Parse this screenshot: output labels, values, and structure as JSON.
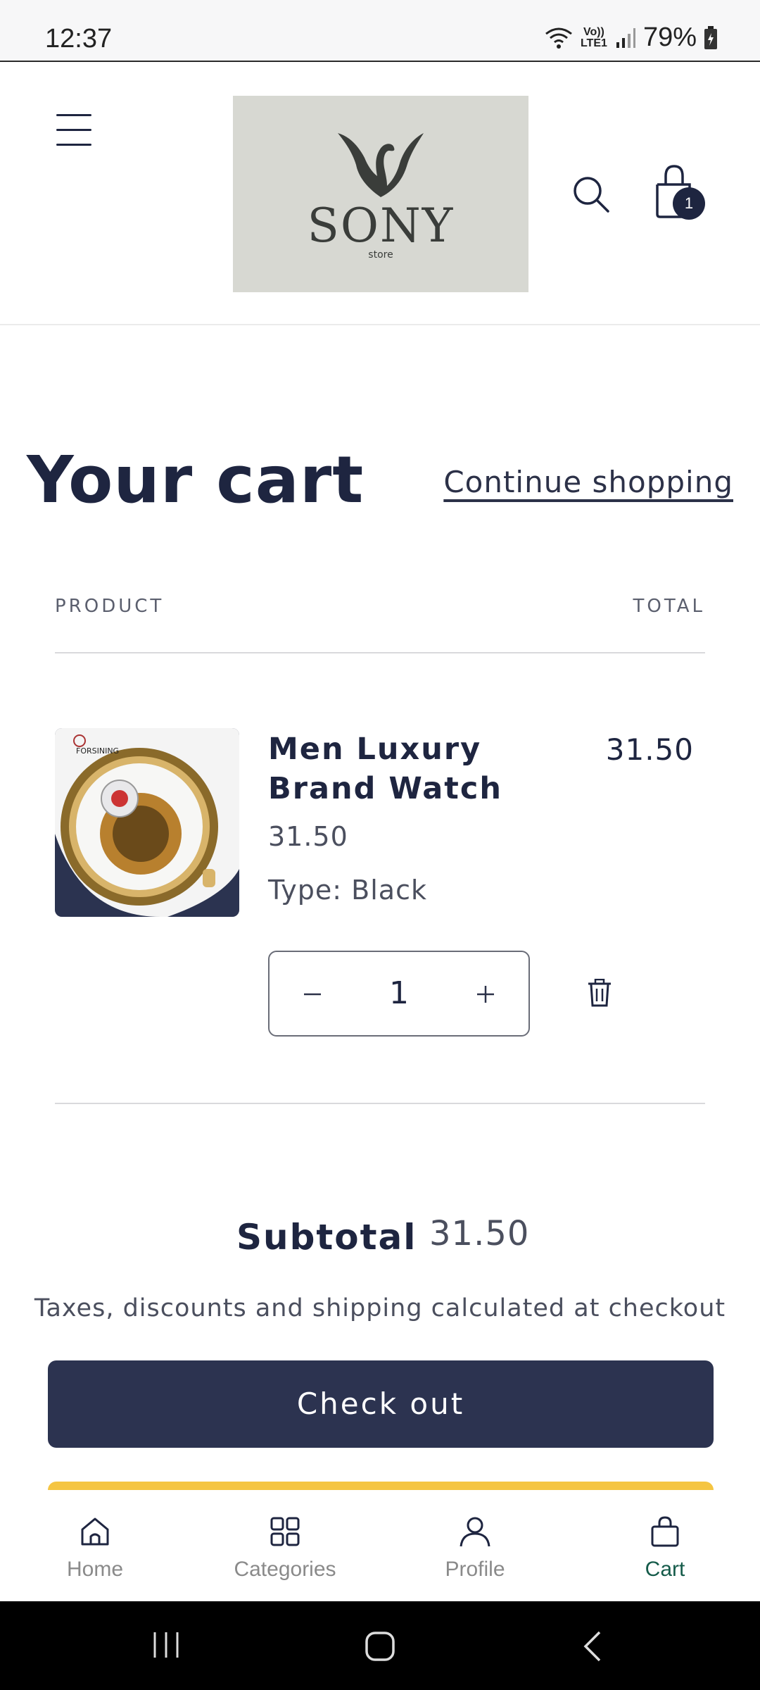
{
  "status_bar": {
    "time": "12:37",
    "network": "Vo)) LTE1",
    "battery": "79%"
  },
  "header": {
    "logo_text": "SONY",
    "logo_subtext": "store",
    "cart_count": "1"
  },
  "cart": {
    "title": "Your cart",
    "continue_label": "Continue shopping",
    "column_product": "PRODUCT",
    "column_total": "TOTAL",
    "items": [
      {
        "brand_mark": "FORSINING",
        "name": "Men Luxury Brand Watch",
        "price": "31.50",
        "variant": "Type: Black",
        "quantity": "1",
        "total": "31.50"
      }
    ],
    "subtotal_label": "Subtotal",
    "subtotal_value": "31.50",
    "tax_note": "Taxes, discounts and shipping calculated at checkout",
    "checkout_label": "Check out"
  },
  "bottom_nav": {
    "items": [
      {
        "label": "Home",
        "icon": "home-icon",
        "active": false
      },
      {
        "label": "Categories",
        "icon": "grid-icon",
        "active": false
      },
      {
        "label": "Profile",
        "icon": "user-icon",
        "active": false
      },
      {
        "label": "Cart",
        "icon": "bag-icon",
        "active": true
      }
    ]
  },
  "colors": {
    "primary": "#2c3350",
    "text": "#1e2540",
    "accent_active": "#155b4a",
    "secondary_button": "#f5c542"
  }
}
